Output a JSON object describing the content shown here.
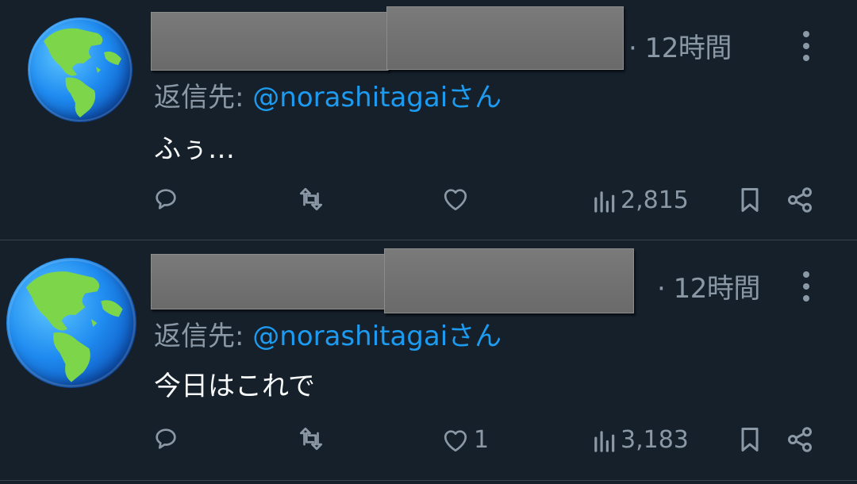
{
  "tweets": [
    {
      "time": "· 12時間",
      "reply_prefix": "返信先: ",
      "reply_handle": "@norashitagai",
      "reply_suffix": "さん",
      "text": "ふぅ…",
      "likes": "",
      "views": "2,815"
    },
    {
      "time": "· 12時間",
      "reply_prefix": "返信先: ",
      "reply_handle": "@norashitagai",
      "reply_suffix": "さん",
      "text": "今日はこれで",
      "likes": "1",
      "views": "3,183"
    }
  ],
  "colors": {
    "background": "#15202b",
    "secondary_text": "#8b98a5",
    "accent": "#1d9bf0",
    "divider": "#38444d"
  },
  "icons": [
    "globe-icon",
    "more-icon",
    "reply-icon",
    "retweet-icon",
    "like-icon",
    "views-icon",
    "bookmark-icon",
    "share-icon"
  ]
}
